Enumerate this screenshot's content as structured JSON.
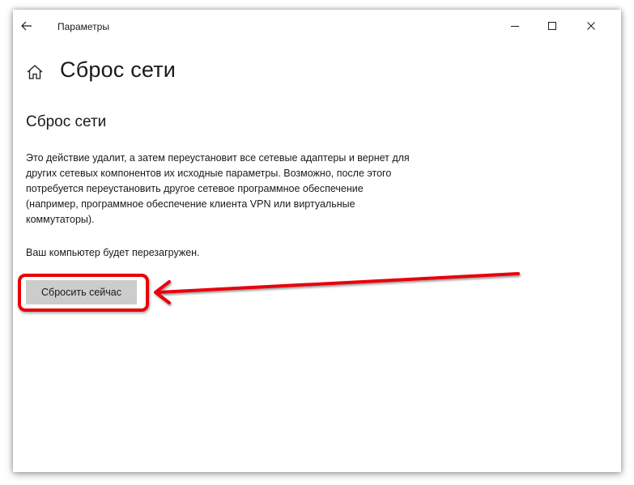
{
  "window": {
    "title": "Параметры"
  },
  "titlebar": {
    "back_icon": "arrow-left-icon",
    "minimize_icon": "minimize-icon",
    "maximize_icon": "maximize-icon",
    "close_icon": "close-icon"
  },
  "header": {
    "home_icon": "home-icon",
    "page_title": "Сброс сети"
  },
  "content": {
    "section_title": "Сброс сети",
    "description": "Это действие удалит, а затем переустановит все сетевые адаптеры и вернет для других сетевых компонентов их исходные параметры. Возможно, после этого потребуется переустановить другое сетевое программное обеспечение (например, программное обеспечение клиента VPN или виртуальные коммутаторы).",
    "restart_note": "Ваш компьютер будет перезагружен.",
    "reset_button_label": "Сбросить сейчас"
  },
  "annotation": {
    "highlight_color": "#e8000a",
    "arrow_color": "#e8000a"
  }
}
